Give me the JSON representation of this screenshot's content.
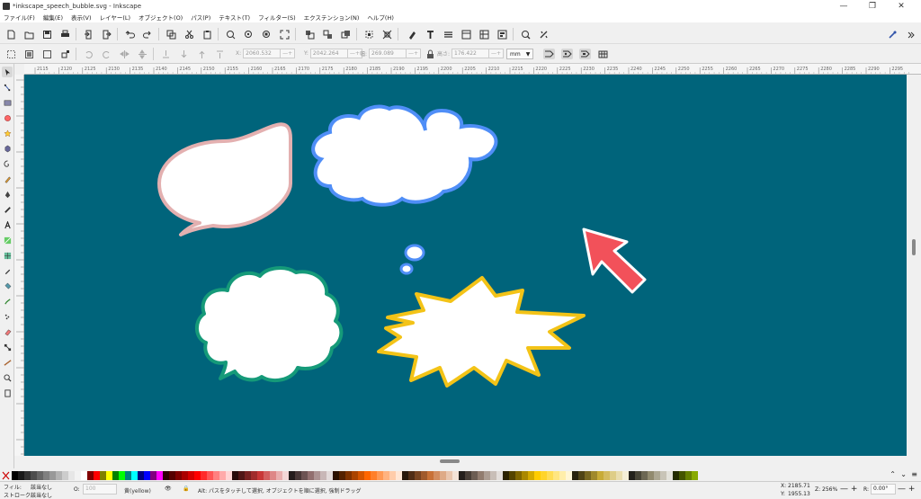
{
  "window": {
    "title": "*inkscape_speech_bubble.svg - Inkscape",
    "controls": [
      "—",
      "❐",
      "✕"
    ]
  },
  "menu": [
    "ファイル(F)",
    "編集(E)",
    "表示(V)",
    "レイヤー(L)",
    "オブジェクト(O)",
    "パス(P)",
    "テキスト(T)",
    "フィルター(S)",
    "エクステンション(N)",
    "ヘルプ(H)"
  ],
  "controls_bar": {
    "x_label": "X:",
    "x_value": "2060.532",
    "y_label": "Y:",
    "y_value": "2042.264",
    "w_label": "幅:",
    "w_value": "269.089",
    "h_label": "高さ:",
    "h_value": "176.422",
    "unit": "mm"
  },
  "ruler_ticks": [
    "2115",
    "2120",
    "2125",
    "2130",
    "2135",
    "2140",
    "2145",
    "2150",
    "2155",
    "2160",
    "2165",
    "2170",
    "2175",
    "2180",
    "2185",
    "2190",
    "2195",
    "2200",
    "2205",
    "2210",
    "2215",
    "2220",
    "2225",
    "2230",
    "2235",
    "2240",
    "2245",
    "2250",
    "2255",
    "2260",
    "2265",
    "2270",
    "2275",
    "2280",
    "2285",
    "2290",
    "2295"
  ],
  "status": {
    "fill_label": "フィル:",
    "fill_value": "該当なし",
    "stroke_label": "ストローク:",
    "stroke_value": "該当なし",
    "opacity_label": "O:",
    "opacity_value": "100",
    "layer_label": "黄(yellow)",
    "message": "Alt: パスをタッチして選択, オブジェクトを順に選択, 強制ドラッグ",
    "cursor_x_label": "X:",
    "cursor_x": "2185.71",
    "cursor_y_label": "Y:",
    "cursor_y": "1955.13",
    "zoom_label": "Z:",
    "zoom": "256%",
    "rotate_label": "R:",
    "rotate": "0.00°"
  },
  "palette_colors": [
    "#000000",
    "#1a1a1a",
    "#333333",
    "#4d4d4d",
    "#666666",
    "#808080",
    "#999999",
    "#b3b3b3",
    "#cccccc",
    "#e6e6e6",
    "#f2f2f2",
    "#ffffff",
    "#800000",
    "#ff0000",
    "#808000",
    "#ffff00",
    "#008000",
    "#00ff00",
    "#008080",
    "#00ffff",
    "#000080",
    "#0000ff",
    "#800080",
    "#ff00ff",
    "#2b0000",
    "#550000",
    "#800000",
    "#aa0000",
    "#d40000",
    "#ff0000",
    "#ff2a2a",
    "#ff5555",
    "#ff8080",
    "#ffaaaa",
    "#ffd5d5",
    "#280b0b",
    "#501616",
    "#782121",
    "#a02c2c",
    "#c83737",
    "#d35f5f",
    "#de8787",
    "#e9afaf",
    "#f4d7d7",
    "#241c1c",
    "#483737",
    "#6c5353",
    "#916f6f",
    "#ac9393",
    "#c8b7b7",
    "#e3dbdb",
    "#2b1100",
    "#552200",
    "#803300",
    "#aa4400",
    "#d45500",
    "#ff6600",
    "#ff7f2a",
    "#ff9955",
    "#ffb380",
    "#ffccaa",
    "#ffe6d5",
    "#28170b",
    "#502d16",
    "#784421",
    "#a05a2c",
    "#c87137",
    "#d38d5f",
    "#deaa87",
    "#e9c6af",
    "#f4e3d7",
    "#241f1c",
    "#483e37",
    "#6c5d53",
    "#917c6f",
    "#ac9d93",
    "#c8beb7",
    "#e3dedb",
    "#2b2200",
    "#554400",
    "#806600",
    "#aa8800",
    "#d4aa00",
    "#ffcc00",
    "#ffd42a",
    "#ffdd55",
    "#ffe680",
    "#ffeeaa",
    "#fff6d5",
    "#28220b",
    "#504416",
    "#786721",
    "#a0892c",
    "#c8ab37",
    "#d4bb5f",
    "#decd87",
    "#e9ddaf",
    "#f4eed7",
    "#24221c",
    "#484537",
    "#6c6753",
    "#918a6f",
    "#aca793",
    "#c8c4b7",
    "#e3e2db",
    "#222b00",
    "#445500",
    "#668000",
    "#88aa00"
  ],
  "colors": {
    "canvas": "#00647b",
    "bubble_pink": "#e3b0b0",
    "bubble_blue": "#4f8ef7",
    "bubble_green": "#159a79",
    "bubble_yellow": "#f3c317",
    "arrow": "#f2515a"
  }
}
